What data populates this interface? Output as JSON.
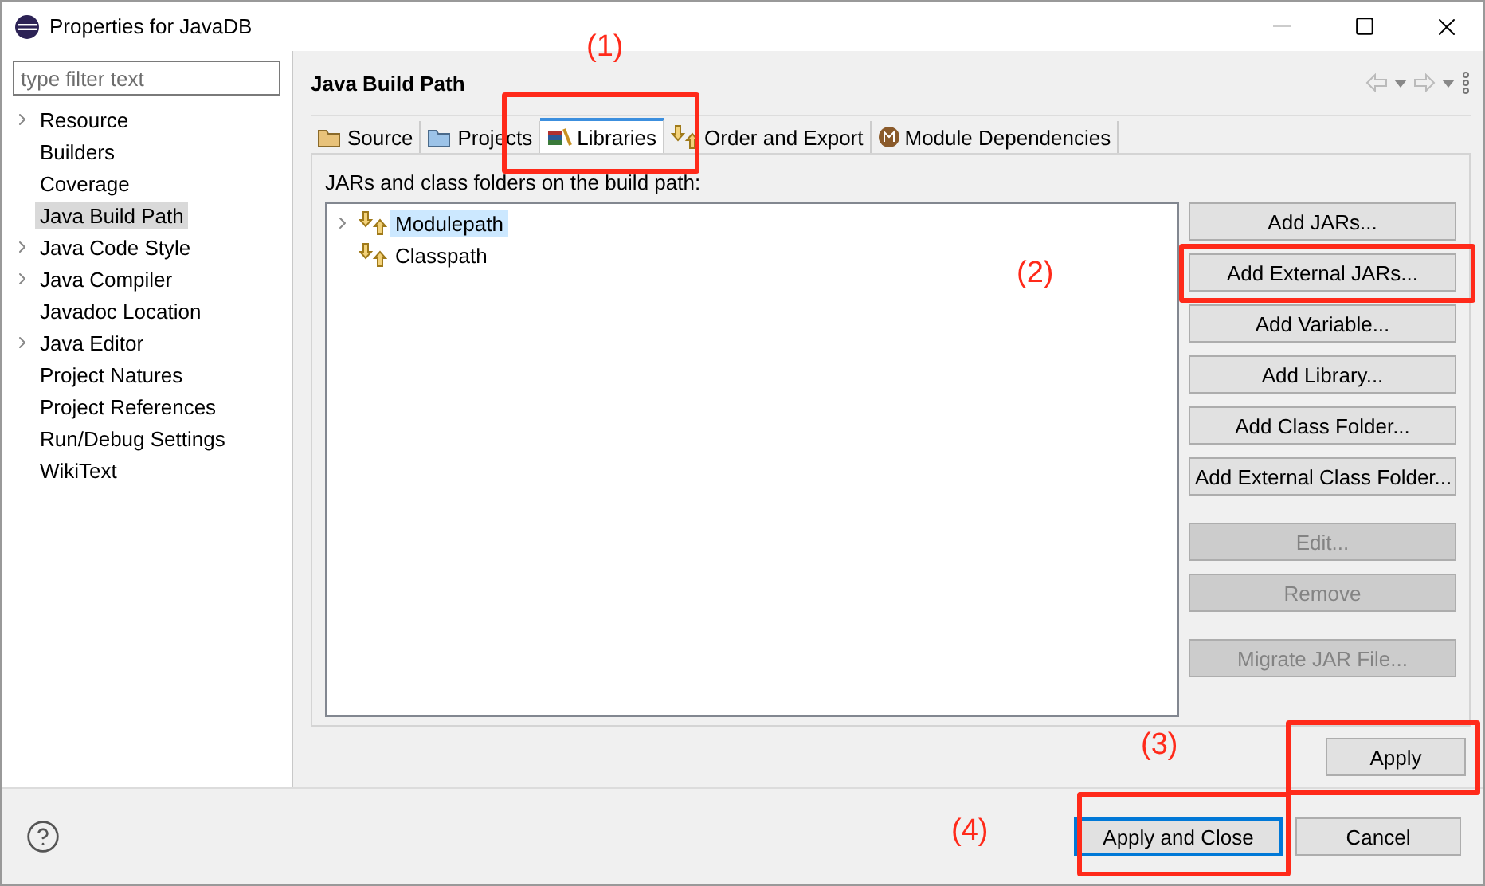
{
  "window": {
    "title": "Properties for JavaDB"
  },
  "sidebar": {
    "filter": {
      "placeholder": "type filter text"
    },
    "items": [
      {
        "label": "Resource",
        "expandable": true,
        "selected": false
      },
      {
        "label": "Builders",
        "expandable": false,
        "selected": false
      },
      {
        "label": "Coverage",
        "expandable": false,
        "selected": false
      },
      {
        "label": "Java Build Path",
        "expandable": false,
        "selected": true
      },
      {
        "label": "Java Code Style",
        "expandable": true,
        "selected": false
      },
      {
        "label": "Java Compiler",
        "expandable": true,
        "selected": false
      },
      {
        "label": "Javadoc Location",
        "expandable": false,
        "selected": false
      },
      {
        "label": "Java Editor",
        "expandable": true,
        "selected": false
      },
      {
        "label": "Project Natures",
        "expandable": false,
        "selected": false
      },
      {
        "label": "Project References",
        "expandable": false,
        "selected": false
      },
      {
        "label": "Run/Debug Settings",
        "expandable": false,
        "selected": false
      },
      {
        "label": "WikiText",
        "expandable": false,
        "selected": false
      }
    ]
  },
  "page": {
    "title": "Java Build Path",
    "tabs": [
      {
        "label": "Source",
        "kind": "source",
        "selected": false
      },
      {
        "label": "Projects",
        "kind": "projects",
        "selected": false
      },
      {
        "label": "Libraries",
        "kind": "libraries",
        "selected": true
      },
      {
        "label": "Order and Export",
        "kind": "order",
        "selected": false
      },
      {
        "label": "Module Dependencies",
        "kind": "module",
        "selected": false
      }
    ],
    "description": "JARs and class folders on the build path:",
    "tree": [
      {
        "label": "Modulepath",
        "expandable": true,
        "selected": true
      },
      {
        "label": "Classpath",
        "expandable": false,
        "selected": false
      }
    ],
    "button_groups": [
      [
        {
          "label": "Add JARs...",
          "disabled": false
        },
        {
          "label": "Add External JARs...",
          "disabled": false
        },
        {
          "label": "Add Variable...",
          "disabled": false
        },
        {
          "label": "Add Library...",
          "disabled": false
        },
        {
          "label": "Add Class Folder...",
          "disabled": false
        },
        {
          "label": "Add External Class Folder...",
          "disabled": false
        }
      ],
      [
        {
          "label": "Edit...",
          "disabled": true
        },
        {
          "label": "Remove",
          "disabled": true
        }
      ],
      [
        {
          "label": "Migrate JAR File...",
          "disabled": true
        }
      ]
    ],
    "apply": {
      "label": "Apply"
    }
  },
  "footer": {
    "buttons": [
      {
        "label": "Apply and Close",
        "default": true
      },
      {
        "label": "Cancel",
        "default": false
      }
    ]
  },
  "annotations": [
    {
      "label": "(1)"
    },
    {
      "label": "(2)"
    },
    {
      "label": "(3)"
    },
    {
      "label": "(4)"
    }
  ]
}
